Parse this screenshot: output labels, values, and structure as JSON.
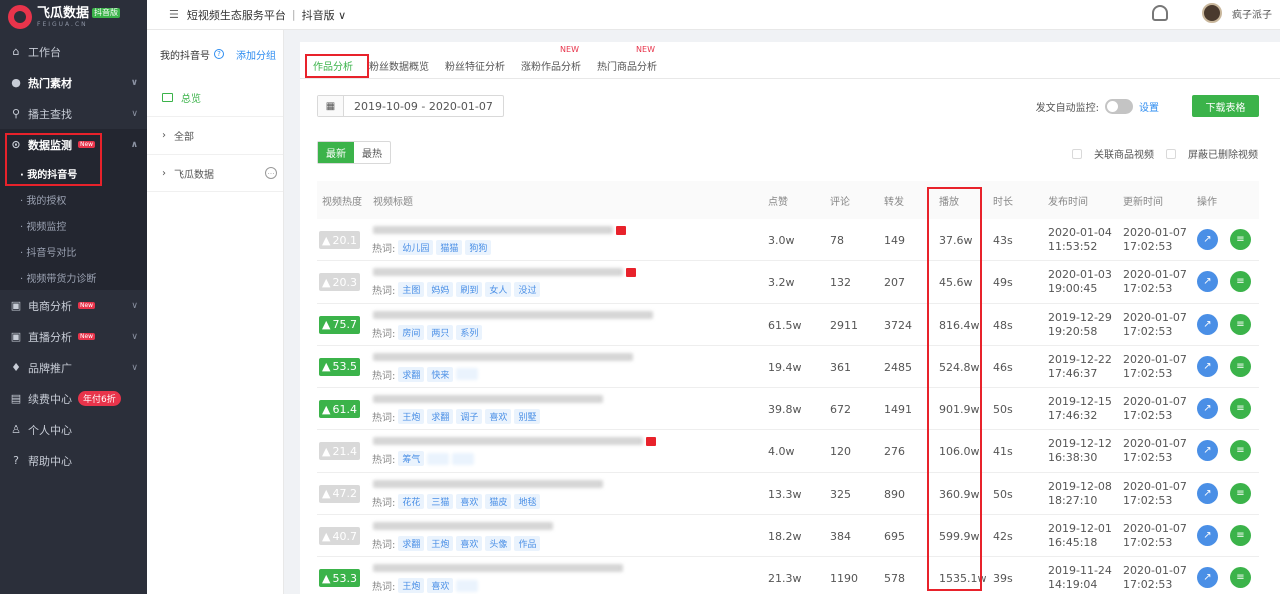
{
  "brand": {
    "name": "飞瓜数据",
    "badge": "抖音版",
    "sub": "FEIGUA.CN"
  },
  "header": {
    "menu_icon": "☰",
    "platform": "短视频生态服务平台",
    "sep": "|",
    "version": "抖音版 ∨",
    "user": "疯子派子"
  },
  "sidebar": {
    "items": [
      {
        "label": "工作台",
        "icon": "⌂"
      },
      {
        "label": "热门素材",
        "icon": "●"
      },
      {
        "label": "播主查找",
        "icon": "⚲"
      },
      {
        "label": "数据监测",
        "icon": "⊙",
        "tag": "New"
      }
    ],
    "sub": [
      "· 我的抖音号",
      "· 我的授权",
      "· 视频监控",
      "· 抖音号对比",
      "· 视频带货力诊断"
    ],
    "items2": [
      {
        "label": "电商分析",
        "icon": "▣",
        "tag": "New"
      },
      {
        "label": "直播分析",
        "icon": "▣",
        "tag": "New"
      },
      {
        "label": "品牌推广",
        "icon": "♦"
      },
      {
        "label": "续费中心",
        "icon": "▤",
        "pill": "年付6折"
      },
      {
        "label": "个人中心",
        "icon": "♙"
      },
      {
        "label": "帮助中心",
        "icon": "?"
      }
    ]
  },
  "panel2": {
    "title": "我的抖音号",
    "help": "?",
    "add": "添加分组",
    "all_selected": "总览",
    "all": "全部",
    "group": "飞瓜数据",
    "more": "…"
  },
  "tabs": [
    {
      "label": "作品分析"
    },
    {
      "label": "粉丝数据概览"
    },
    {
      "label": "粉丝特征分析"
    },
    {
      "label": "涨粉作品分析",
      "new": "NEW"
    },
    {
      "label": "热门商品分析",
      "new": "NEW"
    }
  ],
  "toolbar": {
    "date_range": "2019-10-09 - 2020-01-07",
    "monitor_label": "发文自动监控:",
    "settings": "设置",
    "download": "下载表格"
  },
  "sort": {
    "latest": "最新",
    "hottest": "最热"
  },
  "filters": {
    "related_goods": "关联商品视频",
    "hide_deleted": "屏蔽已删除视频"
  },
  "table": {
    "headers": {
      "heat": "视频热度",
      "title": "视频标题",
      "likes": "点赞",
      "comments": "评论",
      "shares": "转发",
      "plays": "播放",
      "duration": "时长",
      "publish": "发布时间",
      "update": "更新时间",
      "ops": "操作"
    },
    "hot_label": "热词:",
    "rows": [
      {
        "heat": "20.1",
        "hot": false,
        "tags": [
          "幼儿园",
          "猫猫",
          "狗狗"
        ],
        "likes": "3.0w",
        "comments": "78",
        "shares": "149",
        "plays": "37.6w",
        "duration": "43s",
        "pub_date": "2020-01-04",
        "pub_time": "11:53:52",
        "upd_date": "2020-01-07",
        "upd_time": "17:02:53",
        "mark": true
      },
      {
        "heat": "20.3",
        "hot": false,
        "tags": [
          "主图",
          "妈妈",
          "刷到",
          "女人",
          "没过"
        ],
        "likes": "3.2w",
        "comments": "132",
        "shares": "207",
        "plays": "45.6w",
        "duration": "49s",
        "pub_date": "2020-01-03",
        "pub_time": "19:00:45",
        "upd_date": "2020-01-07",
        "upd_time": "17:02:53",
        "mark": true
      },
      {
        "heat": "75.7",
        "hot": true,
        "tags": [
          "房间",
          "两只",
          "系列"
        ],
        "likes": "61.5w",
        "comments": "2911",
        "shares": "3724",
        "plays": "816.4w",
        "duration": "48s",
        "pub_date": "2019-12-29",
        "pub_time": "19:20:58",
        "upd_date": "2020-01-07",
        "upd_time": "17:02:53",
        "mark": false
      },
      {
        "heat": "53.5",
        "hot": true,
        "tags": [
          "求翻",
          "快来"
        ],
        "likes": "19.4w",
        "comments": "361",
        "shares": "2485",
        "plays": "524.8w",
        "duration": "46s",
        "pub_date": "2019-12-22",
        "pub_time": "17:46:37",
        "upd_date": "2020-01-07",
        "upd_time": "17:02:53",
        "mark": false
      },
      {
        "heat": "61.4",
        "hot": true,
        "tags": [
          "王炮",
          "求翻",
          "调子",
          "喜欢",
          "别墅"
        ],
        "likes": "39.8w",
        "comments": "672",
        "shares": "1491",
        "plays": "901.9w",
        "duration": "50s",
        "pub_date": "2019-12-15",
        "pub_time": "17:46:32",
        "upd_date": "2020-01-07",
        "upd_time": "17:02:53",
        "mark": false
      },
      {
        "heat": "21.4",
        "hot": false,
        "tags": [
          "筹气"
        ],
        "likes": "4.0w",
        "comments": "120",
        "shares": "276",
        "plays": "106.0w",
        "duration": "41s",
        "pub_date": "2019-12-12",
        "pub_time": "16:38:30",
        "upd_date": "2020-01-07",
        "upd_time": "17:02:53",
        "mark": true
      },
      {
        "heat": "47.2",
        "hot": false,
        "tags": [
          "花花",
          "三猫",
          "喜欢",
          "猫皮",
          "地毯"
        ],
        "likes": "13.3w",
        "comments": "325",
        "shares": "890",
        "plays": "360.9w",
        "duration": "50s",
        "pub_date": "2019-12-08",
        "pub_time": "18:27:10",
        "upd_date": "2020-01-07",
        "upd_time": "17:02:53",
        "mark": false
      },
      {
        "heat": "40.7",
        "hot": false,
        "tags": [
          "求翻",
          "王炮",
          "喜欢",
          "头像",
          "作品"
        ],
        "likes": "18.2w",
        "comments": "384",
        "shares": "695",
        "plays": "599.9w",
        "duration": "42s",
        "pub_date": "2019-12-01",
        "pub_time": "16:45:18",
        "upd_date": "2020-01-07",
        "upd_time": "17:02:53",
        "mark": false
      },
      {
        "heat": "53.3",
        "hot": true,
        "tags": [
          "王炮",
          "喜欢"
        ],
        "likes": "21.3w",
        "comments": "1190",
        "shares": "578",
        "plays": "1535.1w",
        "duration": "39s",
        "pub_date": "2019-11-24",
        "pub_time": "14:19:04",
        "upd_date": "2020-01-07",
        "upd_time": "17:02:53",
        "mark": false
      }
    ]
  },
  "colors": {
    "accent": "#3bb34a",
    "sidebar": "#2b2f3a",
    "highlight": "#e8222b",
    "link": "#2d8cf0"
  }
}
